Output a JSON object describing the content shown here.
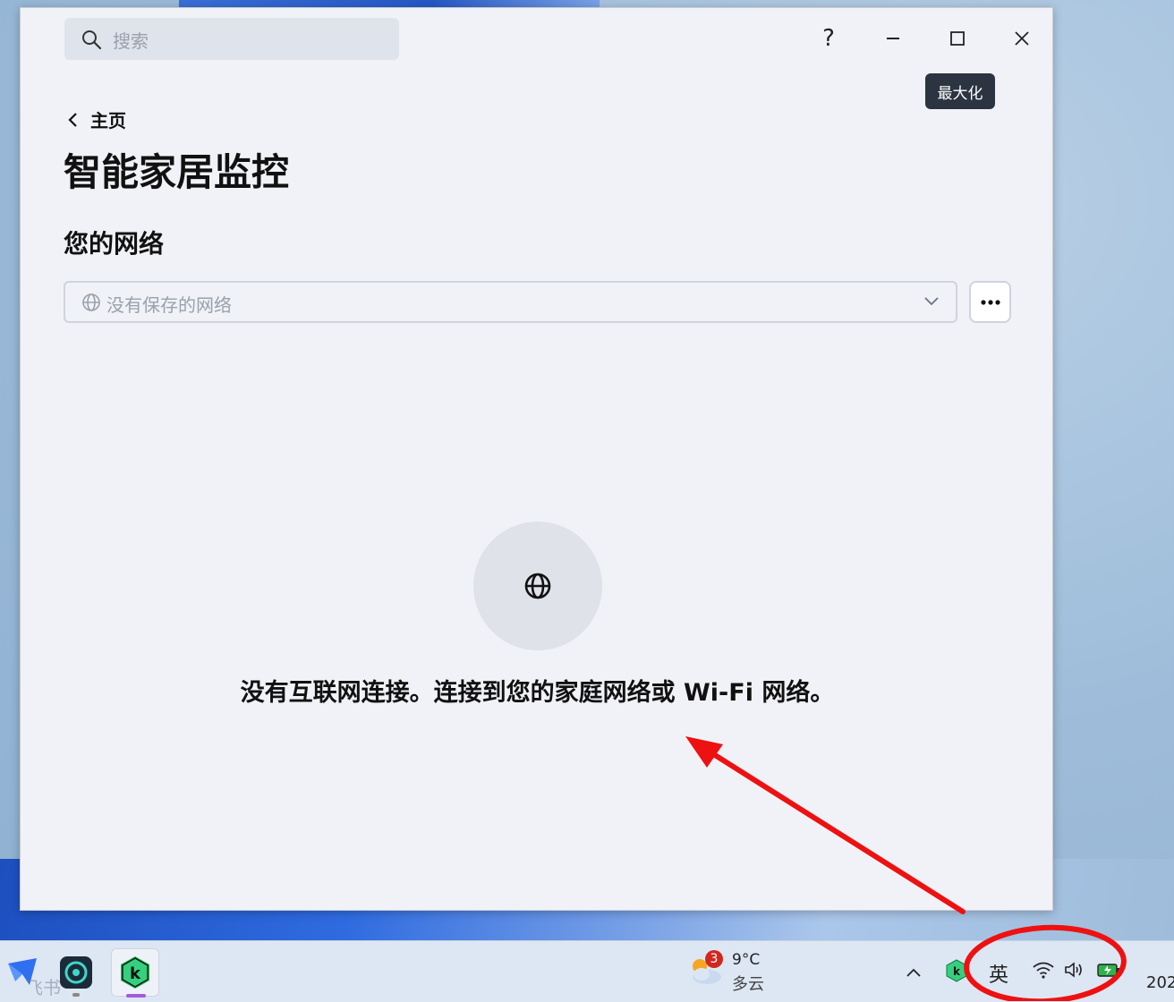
{
  "window": {
    "search_placeholder": "搜索",
    "help_label": "?",
    "tooltip": "最大化",
    "breadcrumb": "主页",
    "title": "智能家居监控",
    "section_title": "您的网络",
    "network_dropdown_value": "没有保存的网络",
    "empty_message": "没有互联网连接。连接到您的家庭网络或 Wi-Fi 网络。"
  },
  "taskbar": {
    "apps": [
      "feishu-icon",
      "vpn-icon",
      "kaspersky-icon"
    ],
    "feishu_label": "飞书",
    "weather": {
      "badge": "3",
      "temp": "9°C",
      "condition": "多云"
    },
    "ime": "英",
    "clock_partial": "202"
  },
  "colors": {
    "accent_annotation": "#ee1111",
    "window_bg": "#f0f2f7",
    "taskbar_bg": "#dde7f3"
  }
}
